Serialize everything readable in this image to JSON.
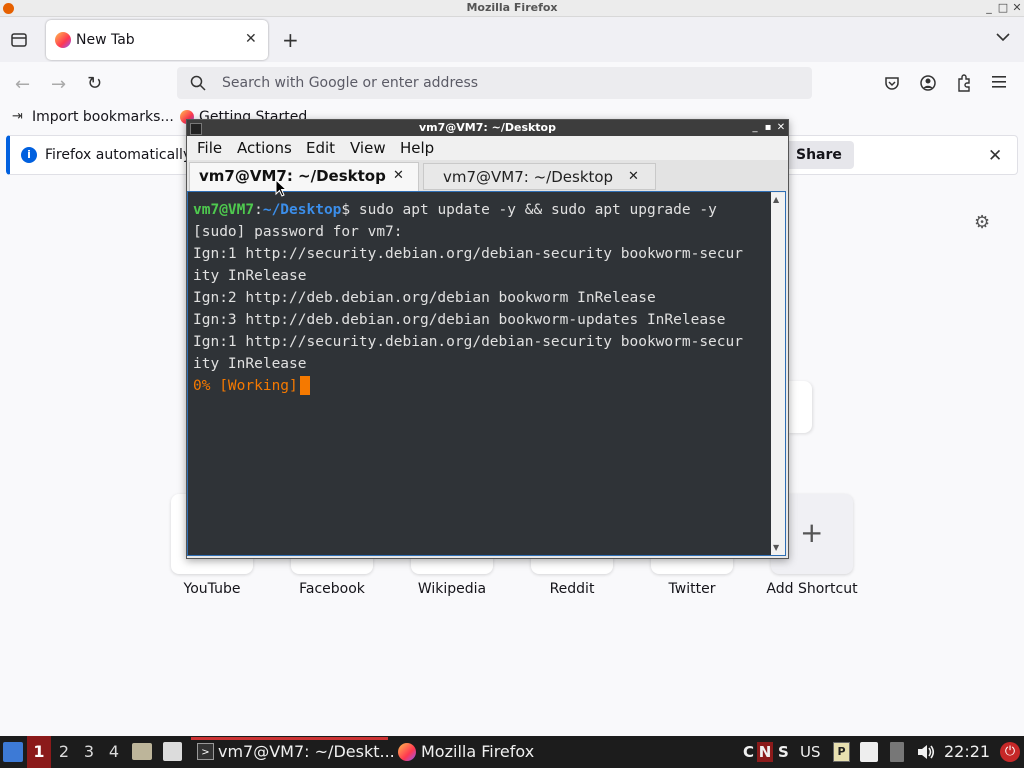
{
  "firefox": {
    "window_title": "Mozilla Firefox",
    "tab_label": "New Tab",
    "url_placeholder": "Search with Google or enter address",
    "bookmarks": [
      "Import bookmarks...",
      "Getting Started"
    ],
    "notification_text": "Firefox automatically",
    "share_label": "Share",
    "shortcuts": [
      "YouTube",
      "Facebook",
      "Wikipedia",
      "Reddit",
      "Twitter",
      "Add Shortcut"
    ]
  },
  "terminal": {
    "title": "vm7@VM7: ~/Desktop",
    "menu": [
      "File",
      "Actions",
      "Edit",
      "View",
      "Help"
    ],
    "tabs": [
      "vm7@VM7: ~/Desktop",
      "vm7@VM7: ~/Desktop"
    ],
    "prompt_user": "vm7@VM7",
    "prompt_sep": ":",
    "prompt_path": "~/Desktop",
    "prompt_dollar": "$",
    "command": " sudo apt update -y && sudo apt upgrade -y",
    "lines": [
      "[sudo] password for vm7:",
      "Ign:1 http://security.debian.org/debian-security bookworm-secur",
      "ity InRelease",
      "Ign:2 http://deb.debian.org/debian bookworm InRelease",
      "Ign:3 http://deb.debian.org/debian bookworm-updates InRelease",
      "Ign:1 http://security.debian.org/debian-security bookworm-secur",
      "ity InRelease"
    ],
    "progress": "0% [Working]",
    "colors": {
      "user": "#4ec94e",
      "path": "#3b8eea",
      "progress": "#f57900",
      "background": "#2f3337"
    }
  },
  "taskbar": {
    "workspaces": [
      "1",
      "2",
      "3",
      "4"
    ],
    "tasks": [
      "vm7@VM7: ~/Deskt...",
      "Mozilla Firefox"
    ],
    "indicators": [
      "C",
      "N",
      "S"
    ],
    "keyboard_layout": "US",
    "clock": "22:21"
  }
}
